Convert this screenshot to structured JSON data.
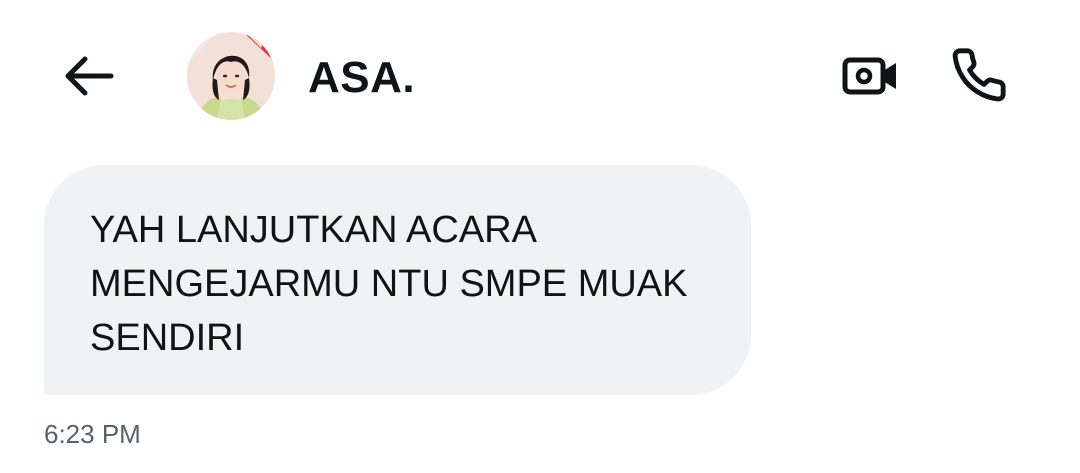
{
  "header": {
    "back_icon": "arrow-left-icon",
    "title": "ASA.",
    "avatar_icon": "profile-photo",
    "video_icon": "video-camera-icon",
    "call_icon": "phone-icon"
  },
  "messages": [
    {
      "text": "YAH LANJUTKAN ACARA\nMENGEJARMU NTU SMPE MUAK\nSENDIRI",
      "time": "6:23 PM"
    }
  ],
  "colors": {
    "bubble_bg": "#eff3f4",
    "text": "#0f1419",
    "timestamp": "#536471"
  }
}
